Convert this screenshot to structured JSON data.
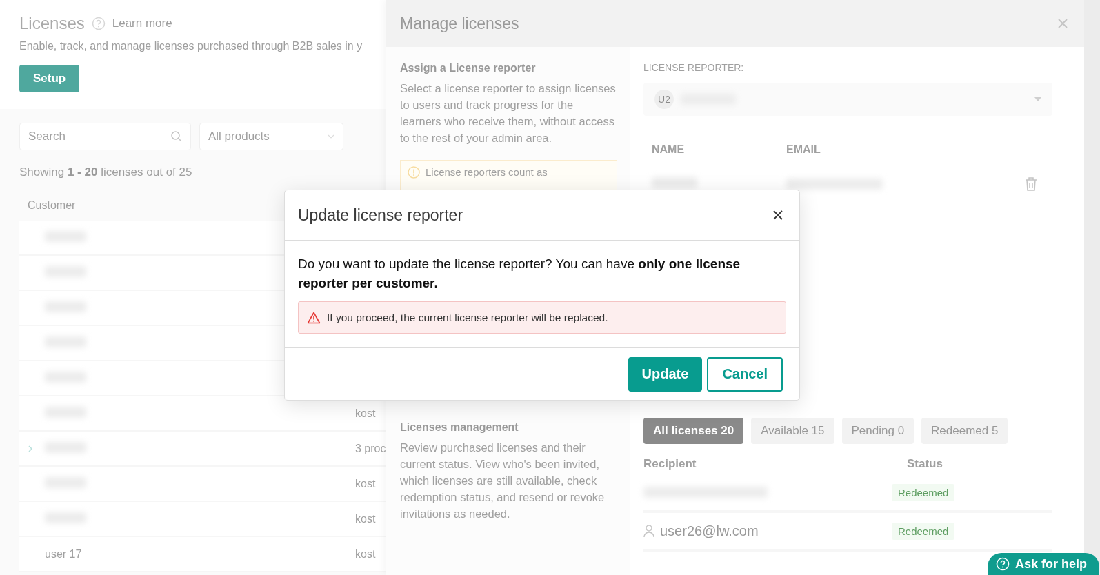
{
  "page": {
    "title": "Licenses",
    "learn_more": "Learn more",
    "subtitle": "Enable, track, and manage licenses purchased through B2B sales in y",
    "setup_button": "Setup",
    "search": {
      "placeholder": "Search"
    },
    "product_filter": {
      "value": "All products"
    },
    "showing": "Showing **1 - 20** licenses out of 25",
    "table": {
      "columns": [
        "Customer"
      ],
      "rows": [
        {
          "expandable": false
        },
        {
          "expandable": false
        },
        {
          "expandable": false
        },
        {
          "expandable": false
        },
        {
          "expandable": false
        },
        {
          "expandable": false,
          "column_2": "kost"
        },
        {
          "expandable": true,
          "column_2": "3 proc"
        },
        {
          "expandable": false,
          "column_2": "kost"
        },
        {
          "expandable": false,
          "column_2": "kost"
        },
        {
          "expandable": false,
          "customer": "user 17",
          "column_2": "kost"
        }
      ]
    }
  },
  "panel": {
    "title": "Manage licenses",
    "reporter_section": {
      "title": "Assign a License reporter",
      "description": "Select a license reporter to assign licenses to users and track progress for the learners who receive them, without access to the rest of your admin area.",
      "notice": "License reporters count as"
    },
    "management_section": {
      "title": "Licenses management",
      "description": "Review purchased licenses and their current status. View who's been invited, which licenses are still available, check redemption status, and resend or revoke invitations as needed."
    },
    "reporter": {
      "label": "LICENSE REPORTER:",
      "avatar": "U2",
      "columns": [
        "NAME",
        "EMAIL"
      ],
      "rows": [
        {}
      ]
    },
    "filters": [
      {
        "label": "All licenses 20",
        "selected": true
      },
      {
        "label": "Available 15",
        "selected": false
      },
      {
        "label": "Pending 0",
        "selected": false
      },
      {
        "label": "Redeemed 5",
        "selected": false
      }
    ],
    "recipients": {
      "columns": [
        "Recipient",
        "Status"
      ],
      "rows": [
        {
          "status": "Redeemed"
        },
        {
          "email": "user26@lw.com",
          "status": "Redeemed"
        }
      ]
    }
  },
  "dialog": {
    "title": "Update license reporter",
    "message": "Do you want to update the license reporter? You can have **only one license reporter per customer.**",
    "alert": "If you proceed, the current license reporter will be replaced.",
    "buttons": [
      {
        "label": "Update",
        "kind": "primary"
      },
      {
        "label": "Cancel",
        "kind": "secondary"
      }
    ]
  },
  "help_button": "Ask for help"
}
